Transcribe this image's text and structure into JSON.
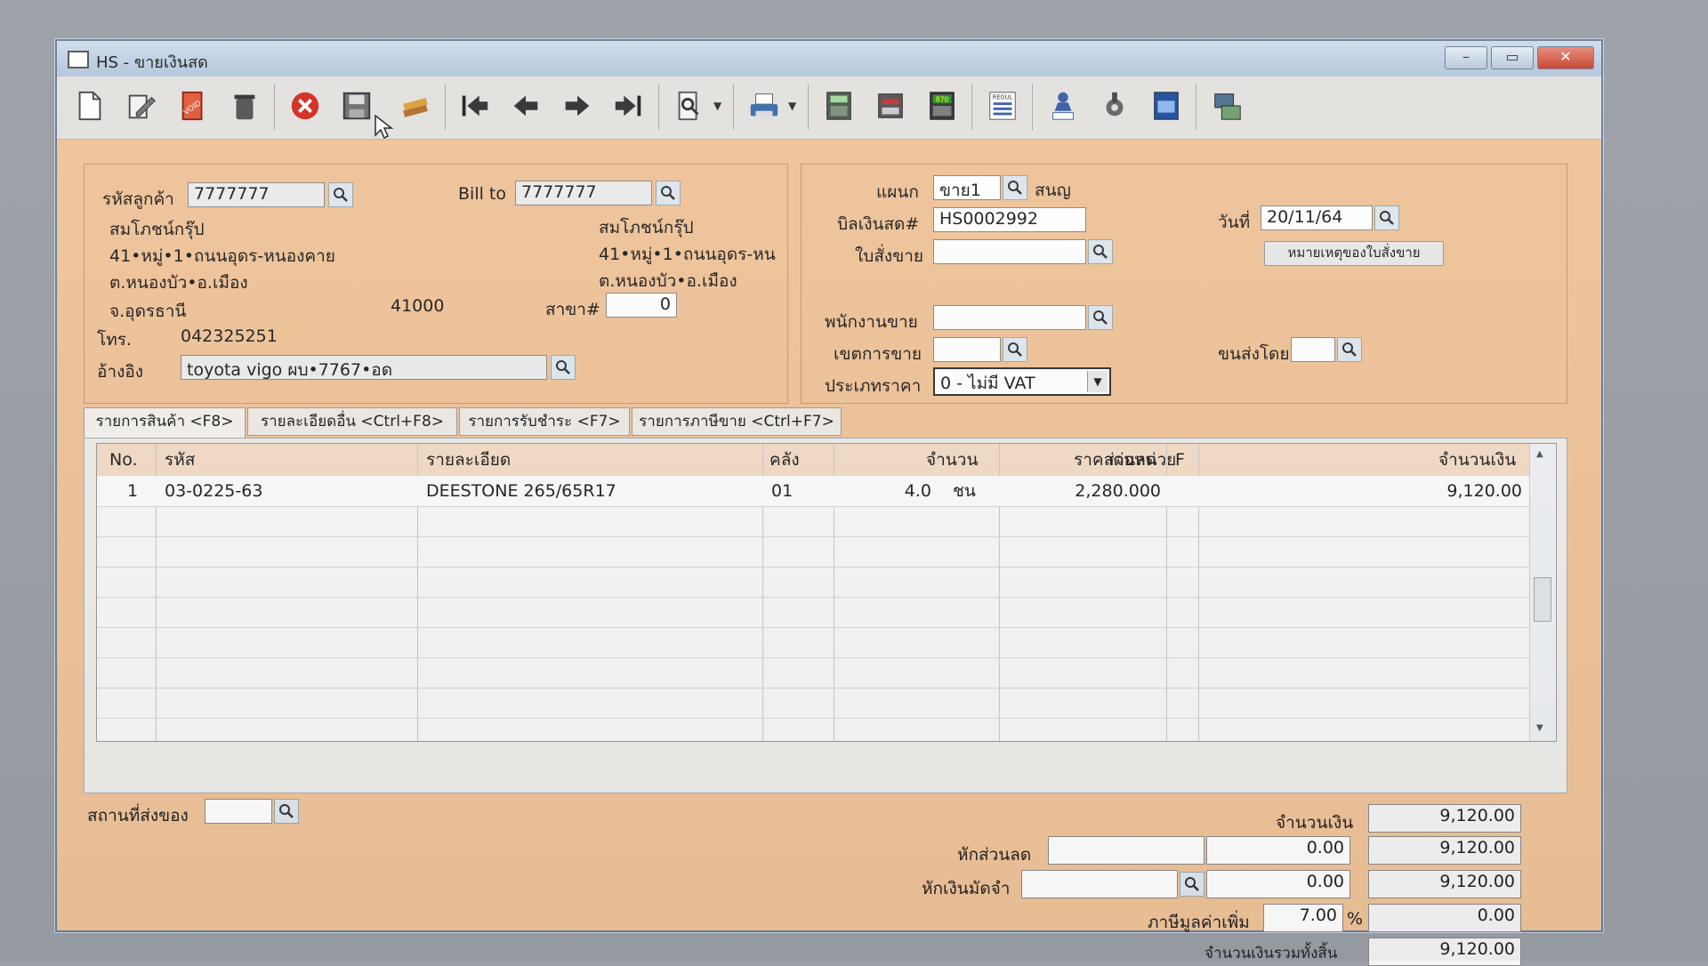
{
  "window": {
    "title": "HS - ขายเงินสด",
    "min": "–",
    "max": "▭",
    "close": "✕"
  },
  "toolbar": [
    "new-doc-icon",
    "edit-doc-icon",
    "void-icon",
    "trash-icon",
    "cancel-icon",
    "save-icon",
    "stack-icon",
    "first-record-icon",
    "prev-record-icon",
    "next-record-icon",
    "last-record-icon",
    "search-doc-icon",
    "printer-icon",
    "calc-icon",
    "register-icon",
    "amount-icon",
    "report-icon",
    "ok-person-icon",
    "tools-icon",
    "ok-doc-icon",
    "network-icon"
  ],
  "toolbar_labels": {
    "void": "VOID",
    "amount": "870",
    "report": "REGUL"
  },
  "customer": {
    "code_label": "รหัสลูกค้า",
    "code": "7777777",
    "name": "สมโภชน์กรุ๊ป",
    "addr1": "41•หมู่•1•ถนนอุดร-หนองคาย",
    "addr2": "ต.หนองบัว•อ.เมือง",
    "addr3": "จ.อุดรธานี",
    "zip": "41000",
    "tel_label": "โทร.",
    "tel": "042325251",
    "ref_label": "อ้างอิง",
    "ref": "toyota vigo ผบ•7767•อด"
  },
  "billto": {
    "label": "Bill to",
    "code": "7777777",
    "name": "สมโภชน์กรุ๊ป",
    "addr1": "41•หมู่•1•ถนนอุดร-หน",
    "addr2": "ต.หนองบัว•อ.เมือง",
    "branch_label": "สาขา#",
    "branch": "0"
  },
  "doc": {
    "dept_label": "แผนก",
    "dept": "ขาย1",
    "dept_name": "สนญ",
    "bill_label": "บิลเงินสด#",
    "bill": "HS0002992",
    "order_label": "ใบสั่งขาย",
    "order": "",
    "date_label": "วันที่",
    "date": "20/11/64",
    "note_button": "หมายเหตุของใบสั่งขาย",
    "sales_label": "พนักงานขาย",
    "sales": "",
    "area_label": "เขตการขาย",
    "area": "",
    "ship_label": "ขนส่งโดย",
    "ship": "",
    "price_label": "ประเภทราคา",
    "price_type": "0 - ไม่มี VAT"
  },
  "tabs": [
    "รายการสินค้า <F8>",
    "รายละเอียดอื่น <Ctrl+F8>",
    "รายการรับชำระ <F7>",
    "รายการภาษีขาย <Ctrl+F7>"
  ],
  "table": {
    "headers": [
      "No.",
      "รหัส",
      "รายละเอียด",
      "คลัง",
      "จำนวน",
      "ราคาต่อหน่วย",
      "ส่วนลด",
      "F",
      "จำนวนเงิน"
    ],
    "rows": [
      {
        "no": "1",
        "code": "03-0225-63",
        "desc": "DEESTONE 265/65R17",
        "wh": "01",
        "qty": "4.0",
        "unit": "ชน",
        "price": "2,280.000",
        "disc": "",
        "f": "",
        "amount": "9,120.00"
      }
    ]
  },
  "footer": {
    "delivery_label": "สถานที่ส่งของ",
    "delivery": "",
    "amount_label": "จำนวนเงิน",
    "amount": "9,120.00",
    "discount_label": "หักส่วนลด",
    "discount_text": "",
    "discount_val": "0.00",
    "after_discount": "9,120.00",
    "deposit_label": "หักเงินมัดจำ",
    "deposit_text": "",
    "deposit_val": "0.00",
    "after_deposit": "9,120.00",
    "vat_label": "ภาษีมูลค่าเพิ่ม",
    "vat_rate": "7.00",
    "vat_pct": "%",
    "vat_amount": "0.00",
    "total_label": "จำนวนเงินรวมทั้งสิ้น",
    "total": "9,120.00"
  }
}
